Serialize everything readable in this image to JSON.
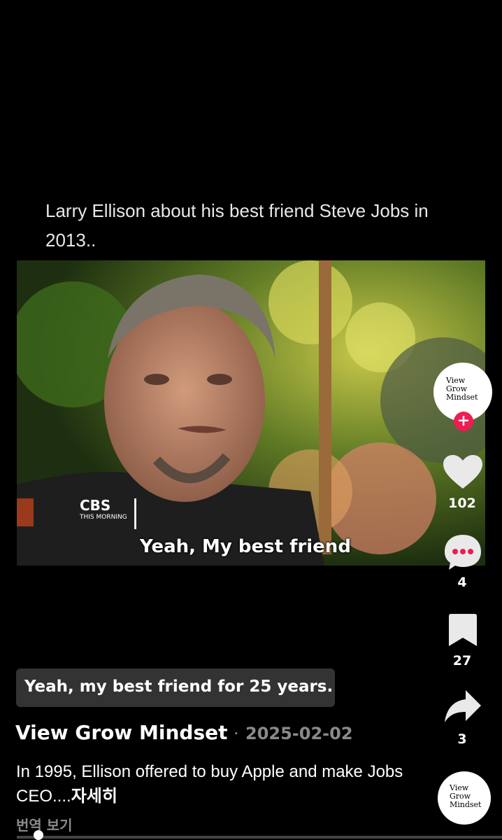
{
  "video": {
    "overlay_title": "Larry Ellison about his best friend Steve Jobs in 2013..",
    "network_logo": "CBS",
    "network_sub": "THIS MORNING",
    "subtitle": "Yeah, My best friend"
  },
  "sidebar": {
    "avatar_text_l1": "View",
    "avatar_text_l2": "Grow",
    "avatar_text_l3": "Mindset",
    "follow_symbol": "+",
    "likes": "102",
    "comments": "4",
    "bookmarks": "27",
    "shares": "3",
    "sound_avatar_l1": "View",
    "sound_avatar_l2": "Grow",
    "sound_avatar_l3": "Mindset"
  },
  "caption_sticker": "Yeah, my best friend for 25 years.",
  "post": {
    "author": "View Grow Mindset",
    "separator": "·",
    "date": "2025-02-02",
    "description": "In 1995, Ellison offered to buy Apple and make Jobs CEO....",
    "more_label": "자세히",
    "translate_label": "번역 보기"
  },
  "playback": {
    "progress": 0.03
  },
  "colors": {
    "follow": "#ee1d52",
    "muted_text": "#8a8a8a",
    "caption_bg": "#333333"
  }
}
